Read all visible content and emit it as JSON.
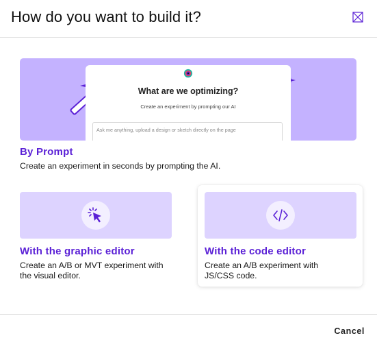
{
  "dialog": {
    "title": "How do you want to build it?",
    "close_icon": "close-icon"
  },
  "prompt_option": {
    "title": "By Prompt",
    "description": "Create an experiment in seconds by prompting the AI.",
    "preview": {
      "heading": "What are we optimizing?",
      "subheading": "Create an experiment by prompting our AI",
      "input_placeholder": "Ask me anything, upload a design or sketch directly on the page"
    },
    "banner_color": "#c4b2ff",
    "icons": [
      "magic-wand-icon",
      "sparkle-icon"
    ]
  },
  "graphic_option": {
    "title": "With the graphic editor",
    "description_line1": "Create an A/B or MVT experiment with",
    "description_line2": "the visual editor.",
    "icon": "cursor-click-icon"
  },
  "code_option": {
    "title": "With the code editor",
    "description_line1": "Create an A/B experiment with",
    "description_line2": "JS/CSS code.",
    "icon": "code-icon",
    "state": "hovered"
  },
  "footer": {
    "cancel_label": "Cancel"
  },
  "colors": {
    "accent": "#5b21d6",
    "banner_light": "#ddd3ff",
    "banner_strong": "#c4b2ff"
  }
}
